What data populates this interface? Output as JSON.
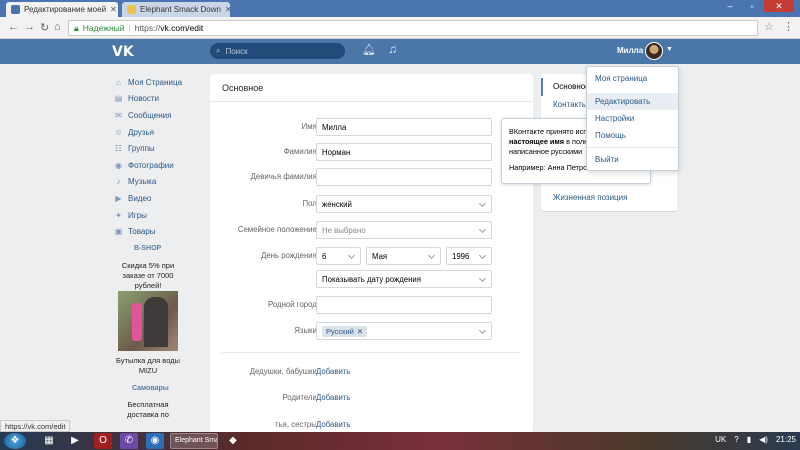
{
  "browser": {
    "tabs": [
      {
        "title": "Редактирование моей",
        "active": true
      },
      {
        "title": "Elephant Smack Down",
        "active": false
      }
    ],
    "secure_label": "Надежный",
    "url_scheme": "https://",
    "url_host": "vk.com/edit",
    "status_url": "https://vk.com/edit"
  },
  "header": {
    "logo": "VK",
    "search_placeholder": "Поиск",
    "user_name": "Милла"
  },
  "leftnav": {
    "items": [
      {
        "label": "Моя Страница",
        "icon": "home-icon",
        "glyph": "⌂"
      },
      {
        "label": "Новости",
        "icon": "news-icon",
        "glyph": "▤"
      },
      {
        "label": "Сообщения",
        "icon": "messages-icon",
        "glyph": "✉"
      },
      {
        "label": "Друзья",
        "icon": "friends-icon",
        "glyph": "☺"
      },
      {
        "label": "Группы",
        "icon": "groups-icon",
        "glyph": "☷"
      },
      {
        "label": "Фотографии",
        "icon": "photos-icon",
        "glyph": "◉"
      },
      {
        "label": "Музыка",
        "icon": "music-icon",
        "glyph": "♪"
      },
      {
        "label": "Видео",
        "icon": "video-icon",
        "glyph": "▶"
      },
      {
        "label": "Игры",
        "icon": "games-icon",
        "glyph": "✦"
      },
      {
        "label": "Товары",
        "icon": "goods-icon",
        "glyph": "▣"
      }
    ],
    "ad1": {
      "title": "B-SHOP",
      "text": "Скидка 5% при заказе от 7000 рублей!",
      "caption": "Бутылка для воды MIZU"
    },
    "ad2": {
      "title": "Самовары",
      "text": "Бесплатная доставка по"
    }
  },
  "form": {
    "title": "Основное",
    "first_name_label": "Имя:",
    "first_name": "Милла",
    "last_name_label": "Фамилия:",
    "last_name": "Норман",
    "maiden_label": "Девичья фамилия:",
    "maiden": "",
    "gender_label": "Пол:",
    "gender": "женский",
    "marital_label": "Семейное положение:",
    "marital": "Не выбрано",
    "birthday_label": "День рождения:",
    "bday_day": "6",
    "bday_month": "Мая",
    "bday_year": "1996",
    "bday_visibility": "Показывать дату рождения",
    "hometown_label": "Родной город:",
    "hometown": "",
    "languages_label": "Языки:",
    "language_chip": "Русский",
    "grandparents_label": "Дедушки, бабушки:",
    "parents_label": "Родители:",
    "siblings_label": "тья, сестры:",
    "add_label": "Добавить"
  },
  "tooltip": {
    "line1": "ВКонтакте принято исп",
    "line2_bold": "настоящее имя",
    "line2_rest": " в полн",
    "line3": "написанное русскими",
    "line4": "Например: Анна Петрова, Ян Иванов."
  },
  "rightmenu": {
    "items": [
      "Основное",
      "Контакты",
      "Жизненная позиция"
    ]
  },
  "dropdown": {
    "items": [
      "Моя страница",
      "Редактировать",
      "Настройки",
      "Помощь",
      "Выйти"
    ]
  },
  "taskbar": {
    "window_title": "Elephant Smack Down",
    "lang": "UK",
    "time": "21:25"
  }
}
